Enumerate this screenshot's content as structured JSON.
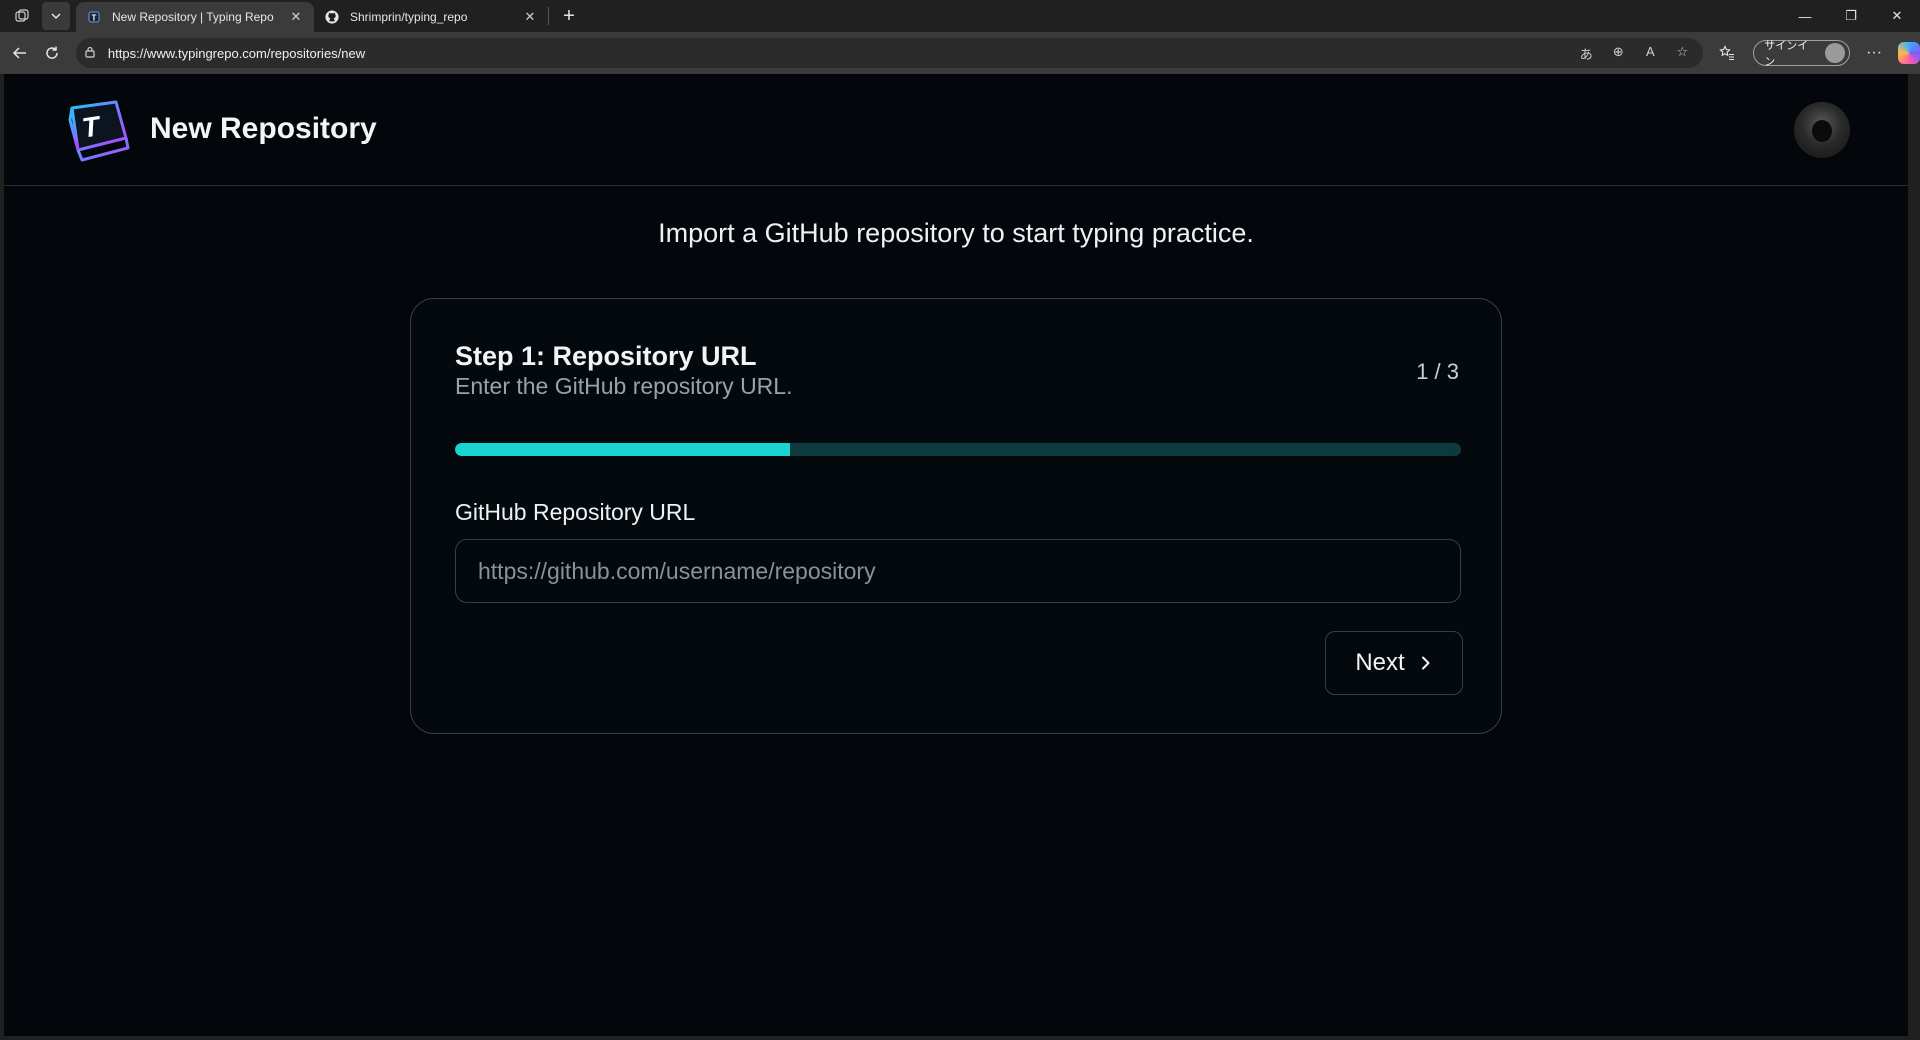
{
  "browser": {
    "tabs": [
      {
        "title": "New Repository | Typing Repo",
        "active": true,
        "favicon": "typing-repo-favicon"
      },
      {
        "title": "Shrimprin/typing_repo",
        "active": false,
        "favicon": "github-icon"
      }
    ],
    "url": "https://www.typingrepo.com/repositories/new",
    "signin_label": "サインイン",
    "icons": [
      "workspaces-icon",
      "tab-list-icon",
      "back-icon",
      "refresh-icon",
      "lock-icon",
      "translate-icon",
      "zoom-icon",
      "read-aloud-icon",
      "favorite-star-icon",
      "favorites-icon",
      "more-icon",
      "copilot-icon"
    ]
  },
  "app": {
    "title": "New Repository",
    "intro": "Import a GitHub repository to start typing practice.",
    "accent": "#19d4d0"
  },
  "wizard": {
    "step_title": "Step 1: Repository URL",
    "step_subtitle": "Enter the GitHub repository URL.",
    "step_counter": "1 / 3",
    "progress": 0.333,
    "field_label": "GitHub Repository URL",
    "field_value": "",
    "field_placeholder": "https://github.com/username/repository",
    "next_label": "Next"
  }
}
